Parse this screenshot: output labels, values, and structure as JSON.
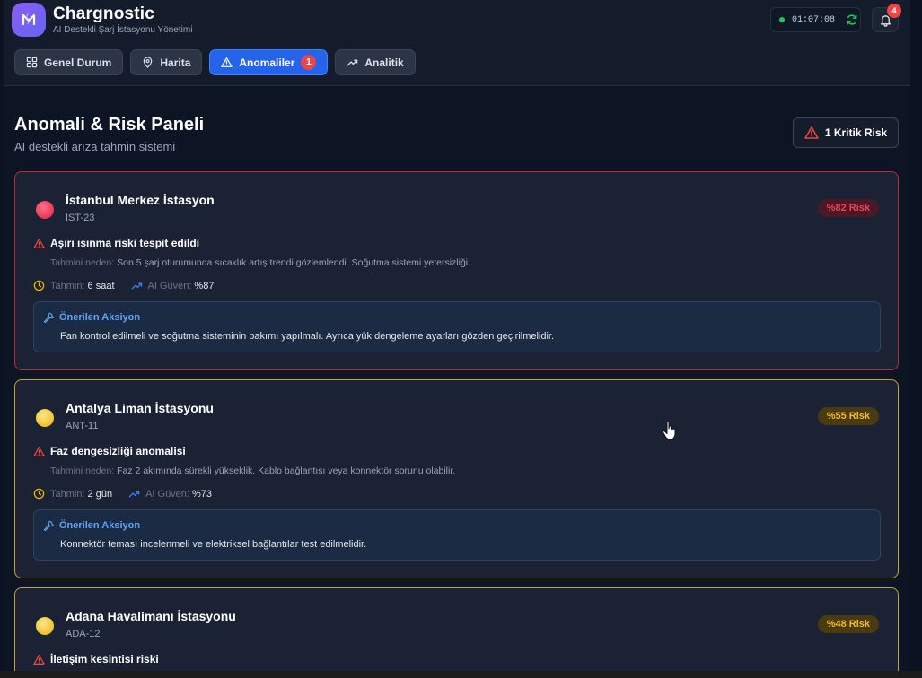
{
  "app": {
    "title": "Chargnostic",
    "subtitle": "AI Destekli Şarj İstasyonu Yönetimi",
    "clock": "01:07:08",
    "notifications": "4"
  },
  "tabs": [
    {
      "label": "Genel Durum",
      "icon": "grid-icon"
    },
    {
      "label": "Harita",
      "icon": "map-pin-icon"
    },
    {
      "label": "Anomaliler",
      "icon": "warning-icon",
      "badge": "1",
      "active": true
    },
    {
      "label": "Analitik",
      "icon": "trend-icon"
    }
  ],
  "page": {
    "title": "Anomali & Risk Paneli",
    "subtitle": "AI destekli arıza tahmin sistemi",
    "critical_button": "1 Kritik Risk"
  },
  "labels": {
    "reason": "Tahmini neden:",
    "eta": "Tahmin:",
    "confidence": "AI Güven:",
    "action_title": "Önerilen Aksiyon"
  },
  "colors": {
    "accent": "#2563eb",
    "critical": "#e11d48",
    "warning": "#eab308",
    "success": "#22c55e"
  },
  "cards": [
    {
      "name": "İstanbul Merkez İstasyon",
      "code": "IST-23",
      "risk": "%82 Risk",
      "level": "red",
      "anomaly": "Aşırı ısınma riski tespit edildi",
      "reason": "Son 5 şarj oturumunda sıcaklık artış trendi gözlemlendi. Soğutma sistemi yetersizliği.",
      "eta": "6 saat",
      "confidence": "%87",
      "action": "Fan kontrol edilmeli ve soğutma sisteminin bakımı yapılmalı. Ayrıca yük dengeleme ayarları gözden geçirilmelidir."
    },
    {
      "name": "Antalya Liman İstasyonu",
      "code": "ANT-11",
      "risk": "%55 Risk",
      "level": "yellow",
      "anomaly": "Faz dengesizliği anomalisi",
      "reason": "Faz 2 akımında sürekli yükseklik. Kablo bağlantısı veya konnektör sorunu olabilir.",
      "eta": "2 gün",
      "confidence": "%73",
      "action": "Konnektör teması incelenmeli ve elektriksel bağlantılar test edilmelidir."
    },
    {
      "name": "Adana Havalimanı İstasyonu",
      "code": "ADA-12",
      "risk": "%48 Risk",
      "level": "yellow",
      "anomaly": "İletişim kesintisi riski"
    }
  ]
}
